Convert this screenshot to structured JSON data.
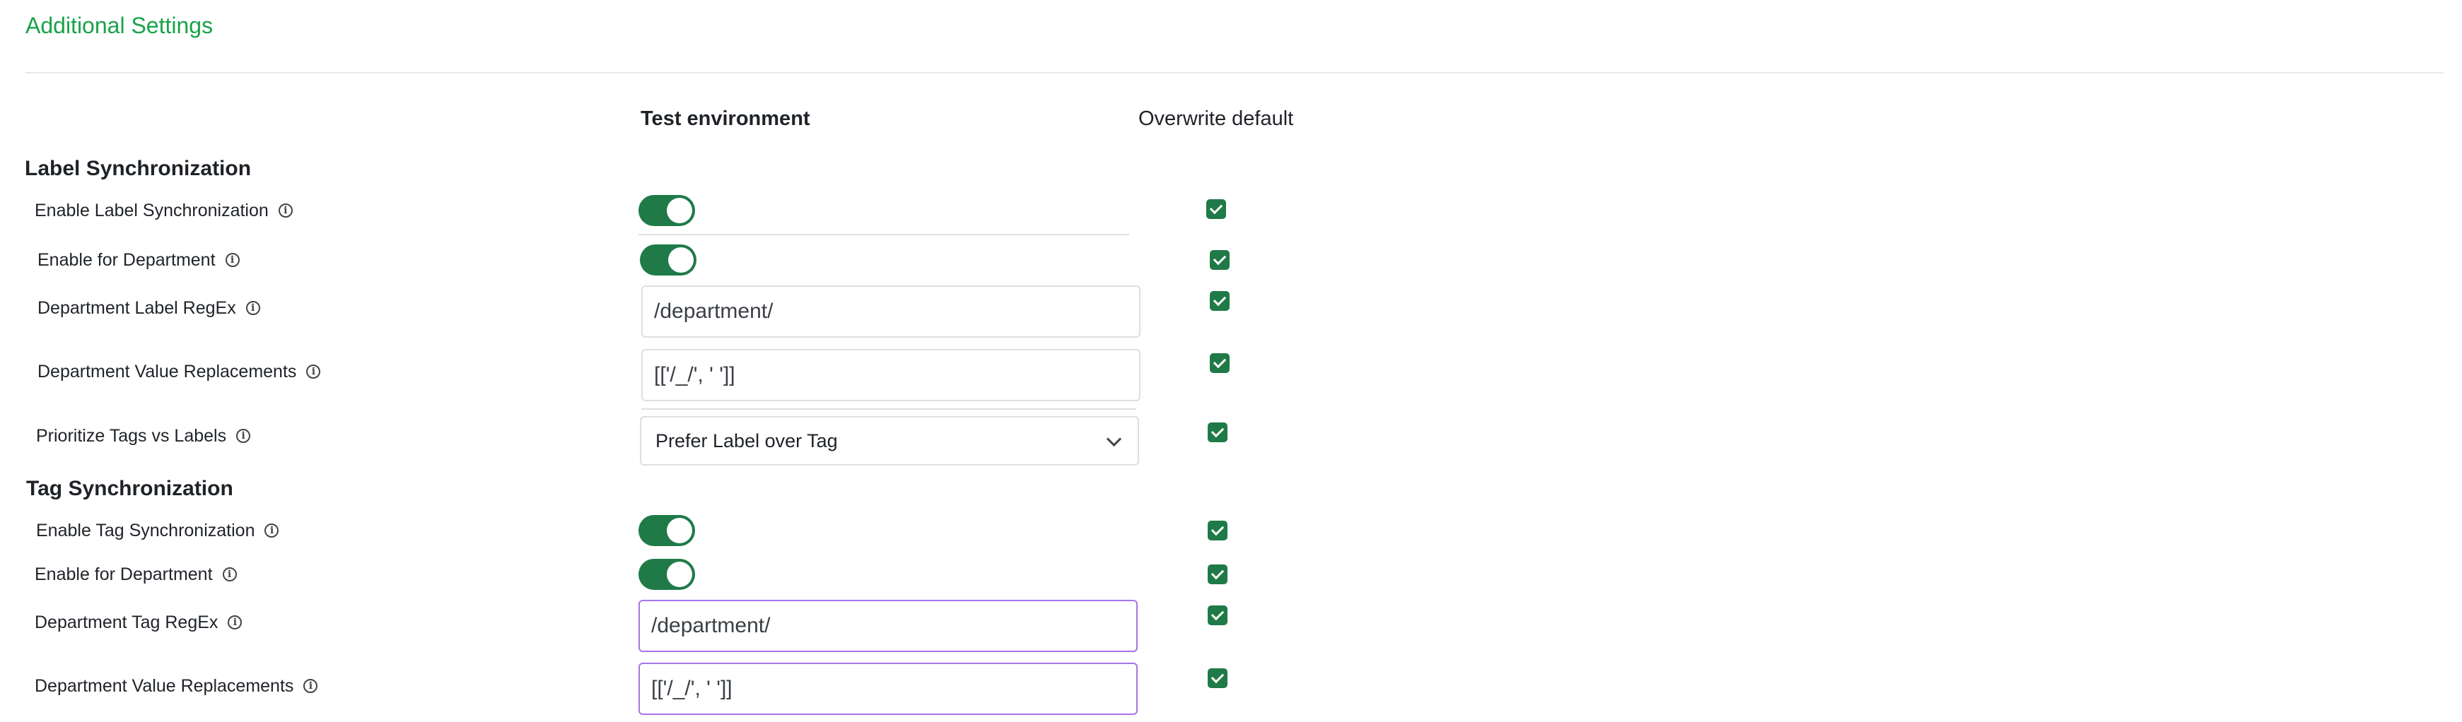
{
  "title": "Additional Settings",
  "columns": {
    "test_environment": "Test environment",
    "overwrite_default": "Overwrite default"
  },
  "label_sync": {
    "heading": "Label Synchronization",
    "enable": {
      "label": "Enable Label Synchronization",
      "on": true,
      "overwrite": true
    },
    "enable_department": {
      "label": "Enable for Department",
      "on": true,
      "overwrite": true
    },
    "department_regex": {
      "label": "Department Label RegEx",
      "value": "/department/",
      "overwrite": true
    },
    "value_replacements": {
      "label": "Department Value Replacements",
      "value": "[['/_/', ' ']]",
      "overwrite": true
    },
    "prioritize": {
      "label": "Prioritize Tags vs Labels",
      "selected": "Prefer Label over Tag",
      "overwrite": true
    }
  },
  "tag_sync": {
    "heading": "Tag Synchronization",
    "enable": {
      "label": "Enable Tag Synchronization",
      "on": true,
      "overwrite": true
    },
    "enable_department": {
      "label": "Enable for Department",
      "on": true,
      "overwrite": true
    },
    "department_regex": {
      "label": "Department Tag RegEx",
      "value": "/department/",
      "overwrite": true
    },
    "value_replacements": {
      "label": "Department Value Replacements",
      "value": "[['/_/', ' ']]",
      "overwrite": true
    }
  },
  "icons": {
    "info": "info-icon",
    "dropdown": "chevron-down-icon",
    "check": "checkmark-icon"
  },
  "colors": {
    "accent_title": "#19a34a",
    "toggle_on": "#1f7a47",
    "checkbox": "#1f7a47",
    "focus_border": "#a774ea"
  }
}
